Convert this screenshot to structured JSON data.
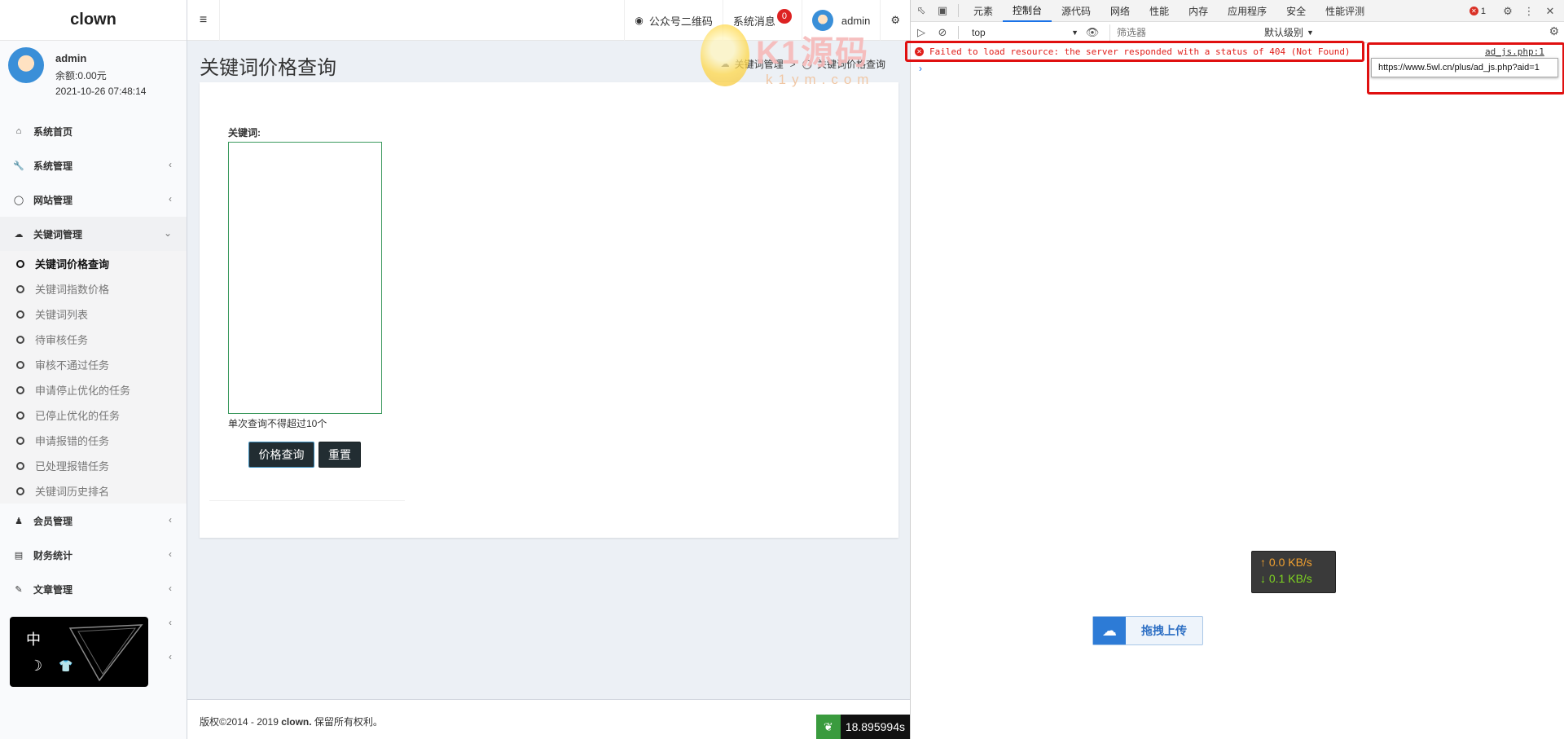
{
  "app": {
    "logo": "clown",
    "user": {
      "name": "admin",
      "balance": "余额:0.00元",
      "time": "2021-10-26 07:48:14"
    }
  },
  "header": {
    "toggle_icon": "≡",
    "qr_label": "公众号二维码",
    "messages_label": "系统消息",
    "messages_count": "0",
    "user_label": "admin"
  },
  "sidebar": {
    "items": [
      {
        "label": "系统首页",
        "icon": "home-icon"
      },
      {
        "label": "系统管理",
        "icon": "wrench-icon"
      },
      {
        "label": "网站管理",
        "icon": "circle-icon"
      },
      {
        "label": "关键词管理",
        "icon": "cloud-icon"
      }
    ],
    "sub_items": [
      "关键词价格查询",
      "关键词指数价格",
      "关键词列表",
      "待审核任务",
      "审核不通过任务",
      "申请停止优化的任务",
      "已停止优化的任务",
      "申请报错的任务",
      "已处理报错任务",
      "关键词历史排名"
    ],
    "items_after": [
      {
        "label": "会员管理",
        "icon": "users-icon"
      },
      {
        "label": "财务统计",
        "icon": "card-icon"
      },
      {
        "label": "文章管理",
        "icon": "edit-icon"
      }
    ],
    "theme_widget": {
      "lang": "中",
      "moon": "☽"
    }
  },
  "content": {
    "title": "关键词价格查询",
    "breadcrumb": [
      "关键词管理",
      "关键词价格查询"
    ],
    "breadcrumb_sep": ">",
    "field_label": "关键词:",
    "textarea_value": "",
    "hint": "单次查询不得超过10个",
    "query_button": "价格查询",
    "reset_button": "重置"
  },
  "footer": {
    "copyright_prefix": "版权©2014 - 2019 ",
    "copyright_brand": "clown.",
    "copyright_suffix": " 保留所有权利。",
    "timer": "18.895994s"
  },
  "watermark": {
    "text": "K1源码",
    "sub": "k1ym.com"
  },
  "devtools": {
    "tabs": [
      "元素",
      "控制台",
      "源代码",
      "网络",
      "性能",
      "内存",
      "应用程序",
      "安全",
      "性能评测"
    ],
    "active_tab": "控制台",
    "error_count": "1",
    "context": "top",
    "filter_placeholder": "筛选器",
    "level": "默认级别",
    "error_message": "Failed to load resource: the server responded with a status of 404 (Not Found)",
    "error_source": "ad_js.php:1",
    "tooltip_url": "https://www.5wl.cn/plus/ad_js.php?aid=1",
    "prompt": "›"
  },
  "overlays": {
    "upload_speed": "↑ 0.0 KB/s",
    "download_speed": "↓ 0.1 KB/s",
    "upload_button": "拖拽上传"
  }
}
